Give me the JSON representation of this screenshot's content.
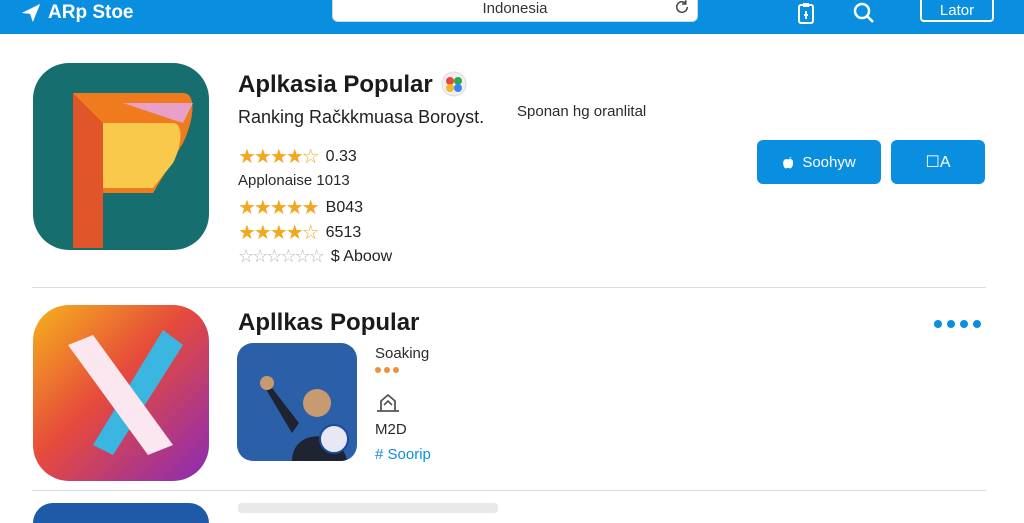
{
  "header": {
    "brand": "ARp Stoe",
    "search_text": "Indonesia",
    "login_label": "Lator"
  },
  "apps": [
    {
      "title": "Aplkasia Popular",
      "subtitle": "Ranking Račkkmuasa Boroyst.",
      "note": "Sponan hg oranlital",
      "rating_value": "0.33",
      "meta": "Applonaise 1013",
      "rating2": "B043",
      "rating3": "6513",
      "price": "$ Aboow",
      "primary_button": "Soohyw",
      "secondary_button": "☐А"
    },
    {
      "title": "Apllkas Popular",
      "label1": "Soaking",
      "label2": "M2D",
      "label3": "# Soorip"
    }
  ],
  "colors": {
    "accent": "#0a8fe0",
    "star": "#f3a71d"
  }
}
